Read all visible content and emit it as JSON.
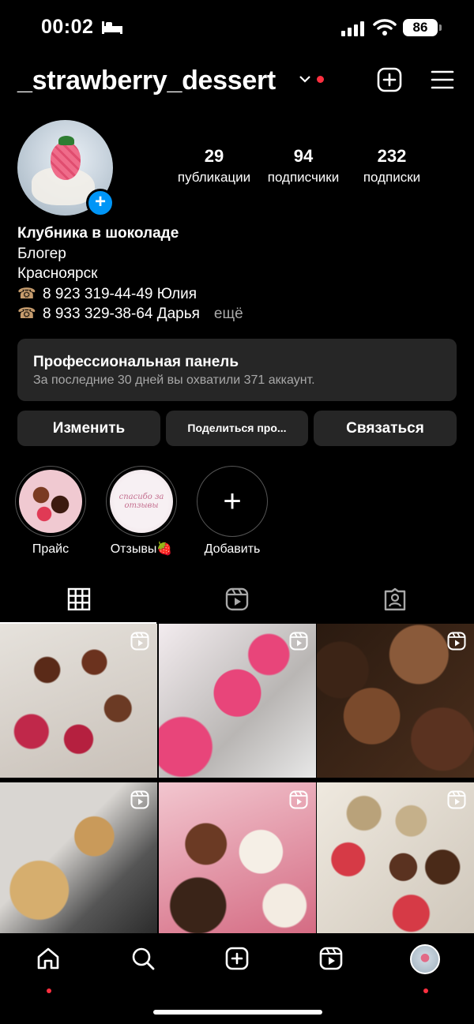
{
  "status_bar": {
    "time": "00:02",
    "battery": "86"
  },
  "header": {
    "username": "_strawberry_dessert"
  },
  "profile": {
    "stats": [
      {
        "value": "29",
        "label": "публикации"
      },
      {
        "value": "94",
        "label": "подписчики"
      },
      {
        "value": "232",
        "label": "подписки"
      }
    ],
    "bio": {
      "name": "Клубника в шоколаде",
      "category": "Блогер",
      "city": "Красноярск",
      "phone1": "8 923 319-44-49 Юлия",
      "phone2": "8 933 329-38-64 Дарья",
      "more": "ещё"
    }
  },
  "pro_panel": {
    "title": "Профессиональная панель",
    "subtitle": "За последние 30 дней вы охватили 371 аккаунт."
  },
  "buttons": {
    "edit": "Изменить",
    "share": "Поделиться про...",
    "contact": "Связаться"
  },
  "highlights": [
    {
      "label": "Прайс"
    },
    {
      "label": "Отзывы🍓",
      "cover_text": "спасибо за отзывы"
    },
    {
      "label": "Добавить"
    }
  ],
  "colors": {
    "accent": "#0095f6",
    "notification": "#ff3040",
    "panel": "#262626"
  }
}
